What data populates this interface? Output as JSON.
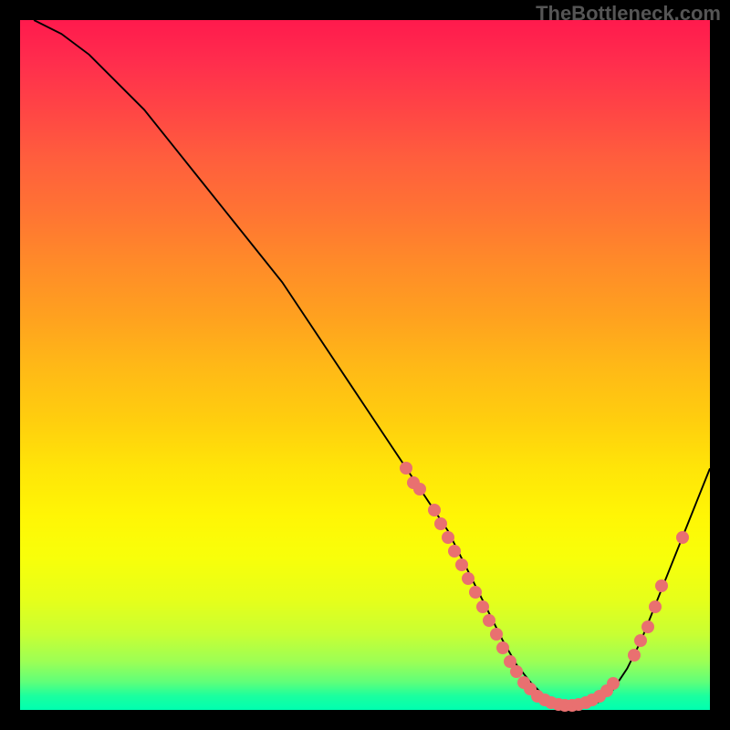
{
  "watermark": "TheBottleneck.com",
  "chart_data": {
    "type": "line",
    "title": "",
    "xlabel": "",
    "ylabel": "",
    "xlim": [
      0,
      100
    ],
    "ylim": [
      0,
      100
    ],
    "series": [
      {
        "name": "curve",
        "x": [
          2,
          6,
          10,
          14,
          18,
          22,
          26,
          30,
          34,
          38,
          42,
          46,
          50,
          54,
          58,
          60,
          62,
          64,
          66,
          68,
          70,
          72,
          74,
          76,
          78,
          80,
          82,
          84,
          86,
          88,
          90,
          92,
          94,
          96,
          98,
          100
        ],
        "y": [
          100,
          98,
          95,
          91,
          87,
          82,
          77,
          72,
          67,
          62,
          56,
          50,
          44,
          38,
          32,
          29,
          26,
          22,
          18,
          14,
          10,
          6.5,
          4,
          2,
          1,
          0.5,
          0.5,
          1.2,
          3,
          6,
          10,
          15,
          20,
          25,
          30,
          35
        ]
      }
    ],
    "points": [
      {
        "x": 56,
        "y": 35
      },
      {
        "x": 57,
        "y": 33
      },
      {
        "x": 58,
        "y": 32
      },
      {
        "x": 60,
        "y": 29
      },
      {
        "x": 61,
        "y": 27
      },
      {
        "x": 62,
        "y": 25
      },
      {
        "x": 63,
        "y": 23
      },
      {
        "x": 64,
        "y": 21
      },
      {
        "x": 65,
        "y": 19
      },
      {
        "x": 66,
        "y": 17
      },
      {
        "x": 67,
        "y": 15
      },
      {
        "x": 68,
        "y": 13
      },
      {
        "x": 69,
        "y": 11
      },
      {
        "x": 70,
        "y": 9
      },
      {
        "x": 71,
        "y": 7
      },
      {
        "x": 72,
        "y": 5.5
      },
      {
        "x": 73,
        "y": 4
      },
      {
        "x": 74,
        "y": 3
      },
      {
        "x": 75,
        "y": 2
      },
      {
        "x": 76,
        "y": 1.4
      },
      {
        "x": 77,
        "y": 1
      },
      {
        "x": 78,
        "y": 0.8
      },
      {
        "x": 79,
        "y": 0.7
      },
      {
        "x": 80,
        "y": 0.7
      },
      {
        "x": 81,
        "y": 0.8
      },
      {
        "x": 82,
        "y": 1
      },
      {
        "x": 83,
        "y": 1.4
      },
      {
        "x": 84,
        "y": 2
      },
      {
        "x": 85,
        "y": 2.8
      },
      {
        "x": 86,
        "y": 3.8
      },
      {
        "x": 89,
        "y": 8
      },
      {
        "x": 90,
        "y": 10
      },
      {
        "x": 91,
        "y": 12
      },
      {
        "x": 92,
        "y": 15
      },
      {
        "x": 93,
        "y": 18
      },
      {
        "x": 96,
        "y": 25
      }
    ],
    "colors": {
      "curve": "#000000",
      "points": "#e97070",
      "gradient_top": "#ff1a4d",
      "gradient_bottom": "#00ffb0"
    }
  }
}
